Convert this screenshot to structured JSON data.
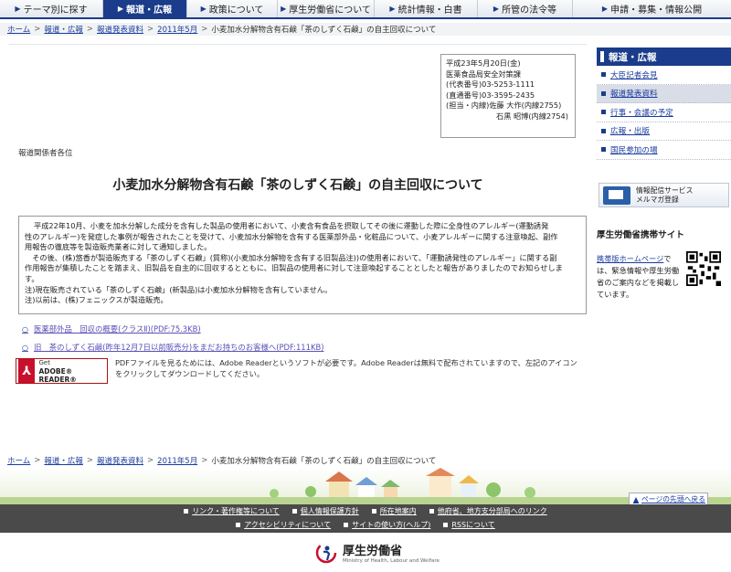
{
  "nav": {
    "items": [
      {
        "label": "テーマ別に探す",
        "prefix": "▶"
      },
      {
        "label": "報道・広報",
        "prefix": "▶"
      },
      {
        "label": "政策について",
        "prefix": "▶"
      },
      {
        "label": "厚生労働省について",
        "prefix": "▶"
      },
      {
        "label": "統計情報・白書",
        "prefix": "▶"
      },
      {
        "label": "所管の法令等",
        "prefix": "▶"
      },
      {
        "label": "申請・募集・情報公開",
        "prefix": "▶"
      }
    ]
  },
  "breadcrumb": {
    "home": "ホーム",
    "l1": "報道・広報",
    "l2": "報道発表資料",
    "l3": "2011年5月",
    "current": "小麦加水分解物含有石鹸「茶のしずく石鹸」の自主回収について",
    "sep": ">"
  },
  "meta": {
    "date": "平成23年5月20日(金)",
    "dept": "医薬食品局安全対策課",
    "tel_rep": "(代表番号)03-5253-1111",
    "tel_dir": "(直通番号)03-3595-2435",
    "contact1": "(担当・内線)佐藤 大作(内線2755)",
    "contact2": "石黒 昭博(内線2754)"
  },
  "addressee": "報道関係者各位",
  "title": "小麦加水分解物含有石鹸「茶のしずく石鹸」の自主回収について",
  "summary": {
    "lines": [
      "平成22年10月、小麦を加水分解した成分を含有した製品の使用者において、小麦含有食品を摂取してその後に運動した際に全身性のアレルギー(運動誘発",
      "性のアレルギー)を発症した事例が報告されたことを受けて、小麦加水分解物を含有する医薬部外品・化粧品について、小麦アレルギーに関する注意喚起、副作",
      "用報告の徹底等を製造販売業者に対して通知しました。",
      "　その後、(株)悠香が製造販売する「茶のしずく石鹸」(質称)(小麦加水分解物を含有する旧製品注))の使用者において、「運動誘発性のアレルギー」に関する副",
      "作用報告が集積したことを踏まえ、旧製品を自主的に回収するとともに、旧製品の使用者に対して注意喚起することとしたと報告がありましたのでお知らせしま",
      "す。",
      "注)現在販売されている「茶のしずく石鹸」(新製品)は小麦加水分解物を含有していません。",
      "注)以前は、(株)フェニックスが製造販売。"
    ]
  },
  "links": [
    {
      "label": "医薬部外品　回収の概要(クラスⅡ)(PDF:75.3KB)",
      "icon": "○"
    },
    {
      "label": "旧　茶のしずく石鹸(昨年12月7日以前販売分)をまだお持ちのお客様へ(PDF:111KB)",
      "icon": "○"
    }
  ],
  "adobe": {
    "get": "Get",
    "reader": "ADOBE® READER®",
    "logo_glyph": "⅄",
    "desc": "PDFファイルを見るためには、Adobe Readerというソフトが必要です。Adobe Readerは無料で配布されていますので、左記のアイコンをクリックしてダウンロードしてください。"
  },
  "sidebar": {
    "header": "報道・広報",
    "items": [
      {
        "label": "大臣記者会見",
        "active": false
      },
      {
        "label": "報道発表資料",
        "active": true
      },
      {
        "label": "行事・会議の予定",
        "active": false
      },
      {
        "label": "広報・出版",
        "active": false
      },
      {
        "label": "国民参加の場",
        "active": false
      }
    ],
    "mail_line1": "情報配信サービス",
    "mail_line2": "メルマガ登録",
    "mobile_header": "厚生労働省携帯サイト",
    "mobile_link": "携帯版ホームページ",
    "mobile_text": "では、緊急情報や厚生労働省のご案内などを掲載しています。"
  },
  "footer": {
    "pagetop": "ページの先頭へ戻る",
    "row1": [
      "リンク・著作権等について",
      "個人情報保護方針",
      "所在地案内",
      "他府省、地方支分部局へのリンク"
    ],
    "row2": [
      "アクセシビリティについて",
      "サイトの使い方(ヘルプ)",
      "RSSについて"
    ],
    "logo_jp": "厚生労働省",
    "logo_en": "Ministry of Health, Labour and Welfare"
  }
}
